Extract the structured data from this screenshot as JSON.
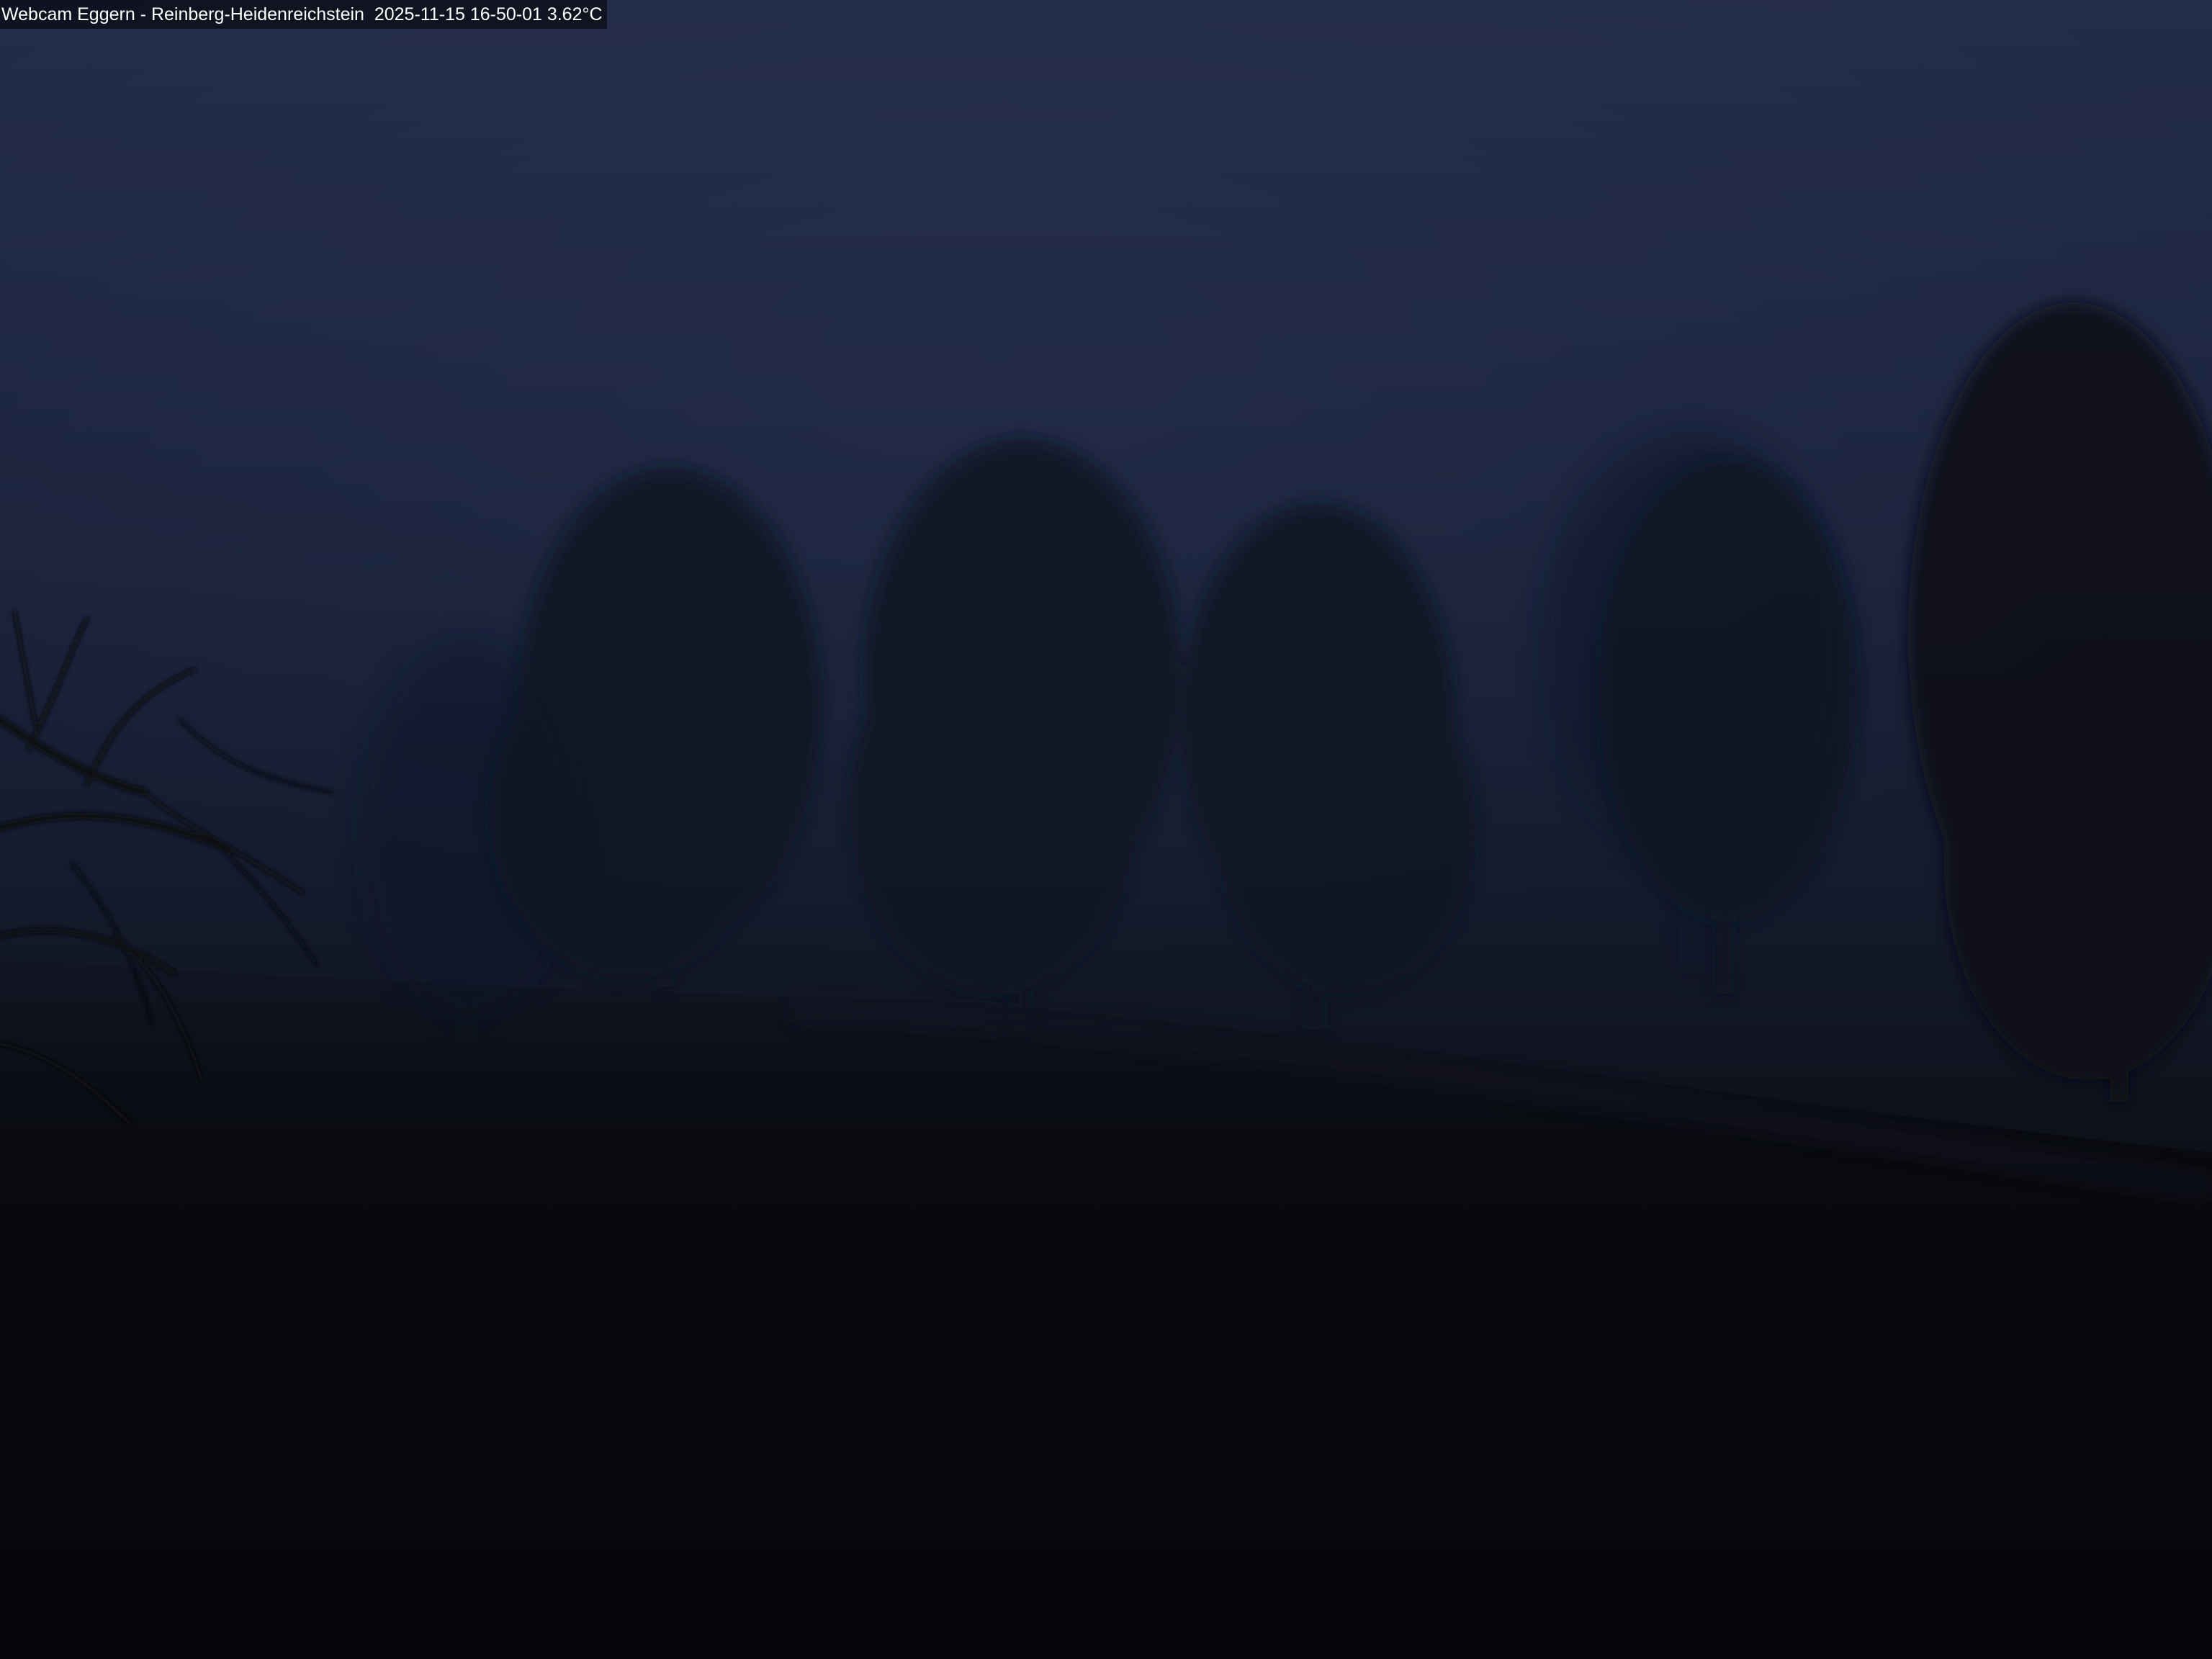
{
  "image": {
    "overlay": {
      "caption": "Webcam Eggern - Reinberg-Heidenreichstein  2025-11-15 16-50-01 3.62°C"
    },
    "palette": {
      "sky_top": "#232c4a",
      "sky_mid": "#1b233c",
      "horizon": "#141a2b",
      "ground_far": "#0d1018",
      "ground_near": "#07080c",
      "tree_dark": "#0a0c14"
    }
  }
}
